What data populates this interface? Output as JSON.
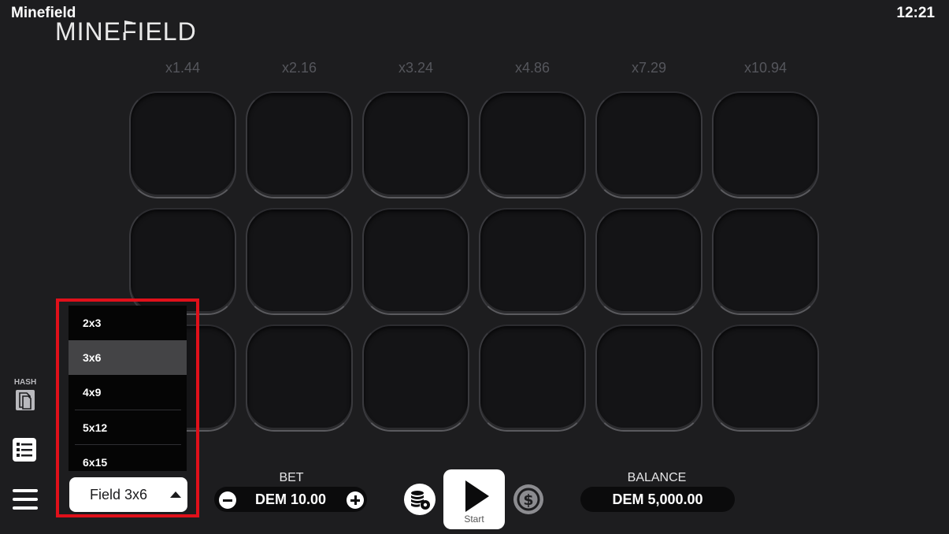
{
  "app": {
    "title": "Minefield",
    "clock": "12:21",
    "logo": "MINEFIELD"
  },
  "multipliers": [
    "x1.44",
    "x2.16",
    "x3.24",
    "x4.86",
    "x7.29",
    "x10.94"
  ],
  "grid": {
    "rows": 3,
    "cols": 6
  },
  "sidebar": {
    "hash_label": "HASH"
  },
  "field_dropdown": {
    "options": [
      "2x3",
      "3x6",
      "4x9",
      "5x12",
      "6x15"
    ],
    "selected": "3x6",
    "button_label": "Field 3x6"
  },
  "bet": {
    "label": "BET",
    "value": "DEM 10.00"
  },
  "start": {
    "label": "Start"
  },
  "balance": {
    "label": "BALANCE",
    "value": "DEM 5,000.00"
  },
  "colors": {
    "highlight_frame": "#e0101a",
    "background": "#1d1d1f"
  }
}
